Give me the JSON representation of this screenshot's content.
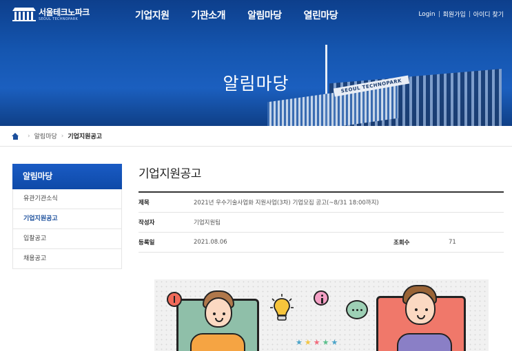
{
  "header": {
    "logo_ko": "서울테크노파크",
    "logo_en": "SEOUL TECHNOPARK",
    "nav": [
      "기업지원",
      "기관소개",
      "알림마당",
      "열린마당"
    ],
    "util": [
      "Login",
      "회원가입",
      "아이디 찾기"
    ],
    "hero_title": "알림마당",
    "building_sign": "SEOUL TECHNOPARK"
  },
  "breadcrumb": {
    "items": [
      "알림마당",
      "기업지원공고"
    ]
  },
  "sidebar": {
    "title": "알림마당",
    "items": [
      {
        "label": "유관기관소식",
        "active": false
      },
      {
        "label": "기업지원공고",
        "active": true
      },
      {
        "label": "입찰공고",
        "active": false
      },
      {
        "label": "채용공고",
        "active": false
      }
    ]
  },
  "content": {
    "page_title": "기업지원공고",
    "rows": {
      "subject_label": "제목",
      "subject_value": "2021년 우수기술사업화 지원사업(3차) 기업모집 공고(~8/31 18:00까지)",
      "author_label": "작성자",
      "author_value": "기업지원팀",
      "date_label": "등록일",
      "date_value": "2021.08.06",
      "views_label": "조회수",
      "views_value": "71"
    }
  },
  "colors": {
    "brand_blue": "#0e4aa8",
    "header_blue": "#1556b0"
  },
  "icons": [
    "home-icon",
    "lightbulb-icon",
    "chat-bubble-icon",
    "info-icon",
    "alert-icon",
    "star-icon"
  ]
}
